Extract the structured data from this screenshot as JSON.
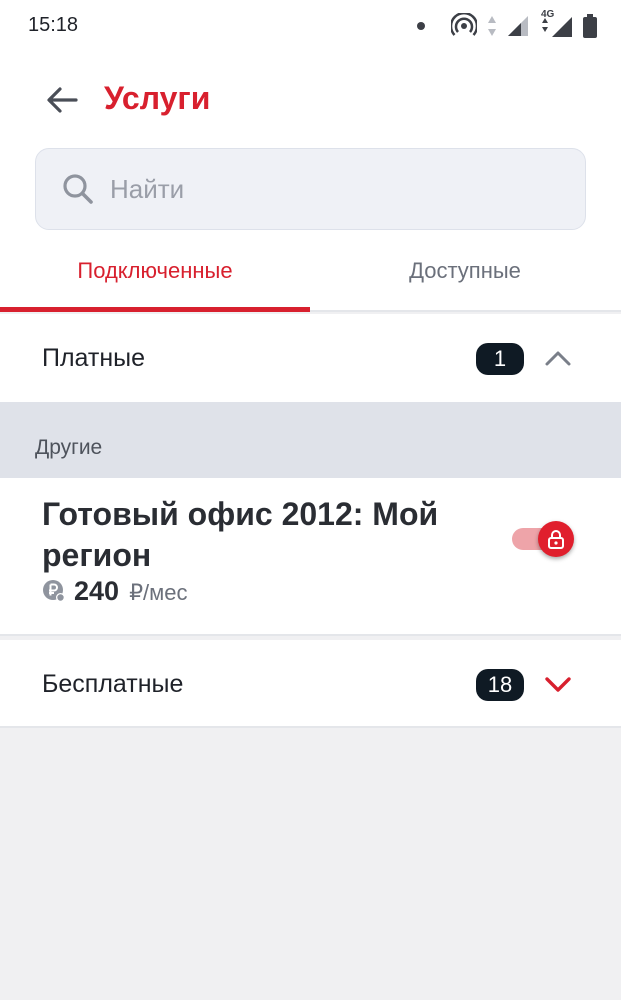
{
  "status_bar": {
    "time": "15:18",
    "network": "4G"
  },
  "header": {
    "title": "Услуги",
    "back_icon": "arrow-left-icon"
  },
  "search": {
    "placeholder": "Найти"
  },
  "tabs": [
    {
      "label": "Подключенные",
      "active": true
    },
    {
      "label": "Доступные",
      "active": false
    }
  ],
  "paid_section": {
    "title": "Платные",
    "count": "1",
    "expanded": true
  },
  "group": {
    "label": "Другие"
  },
  "service": {
    "name": "Готовый офис 2012: Мой регион",
    "price": "240",
    "price_unit": "₽/мес",
    "toggle_state": "on-locked"
  },
  "free_section": {
    "title": "Бесплатные",
    "count": "18",
    "expanded": false
  },
  "colors": {
    "accent": "#d8202e",
    "badge": "#0f1a24",
    "group_bg": "#dfe2e9",
    "page_bg": "#f0f0f2"
  }
}
